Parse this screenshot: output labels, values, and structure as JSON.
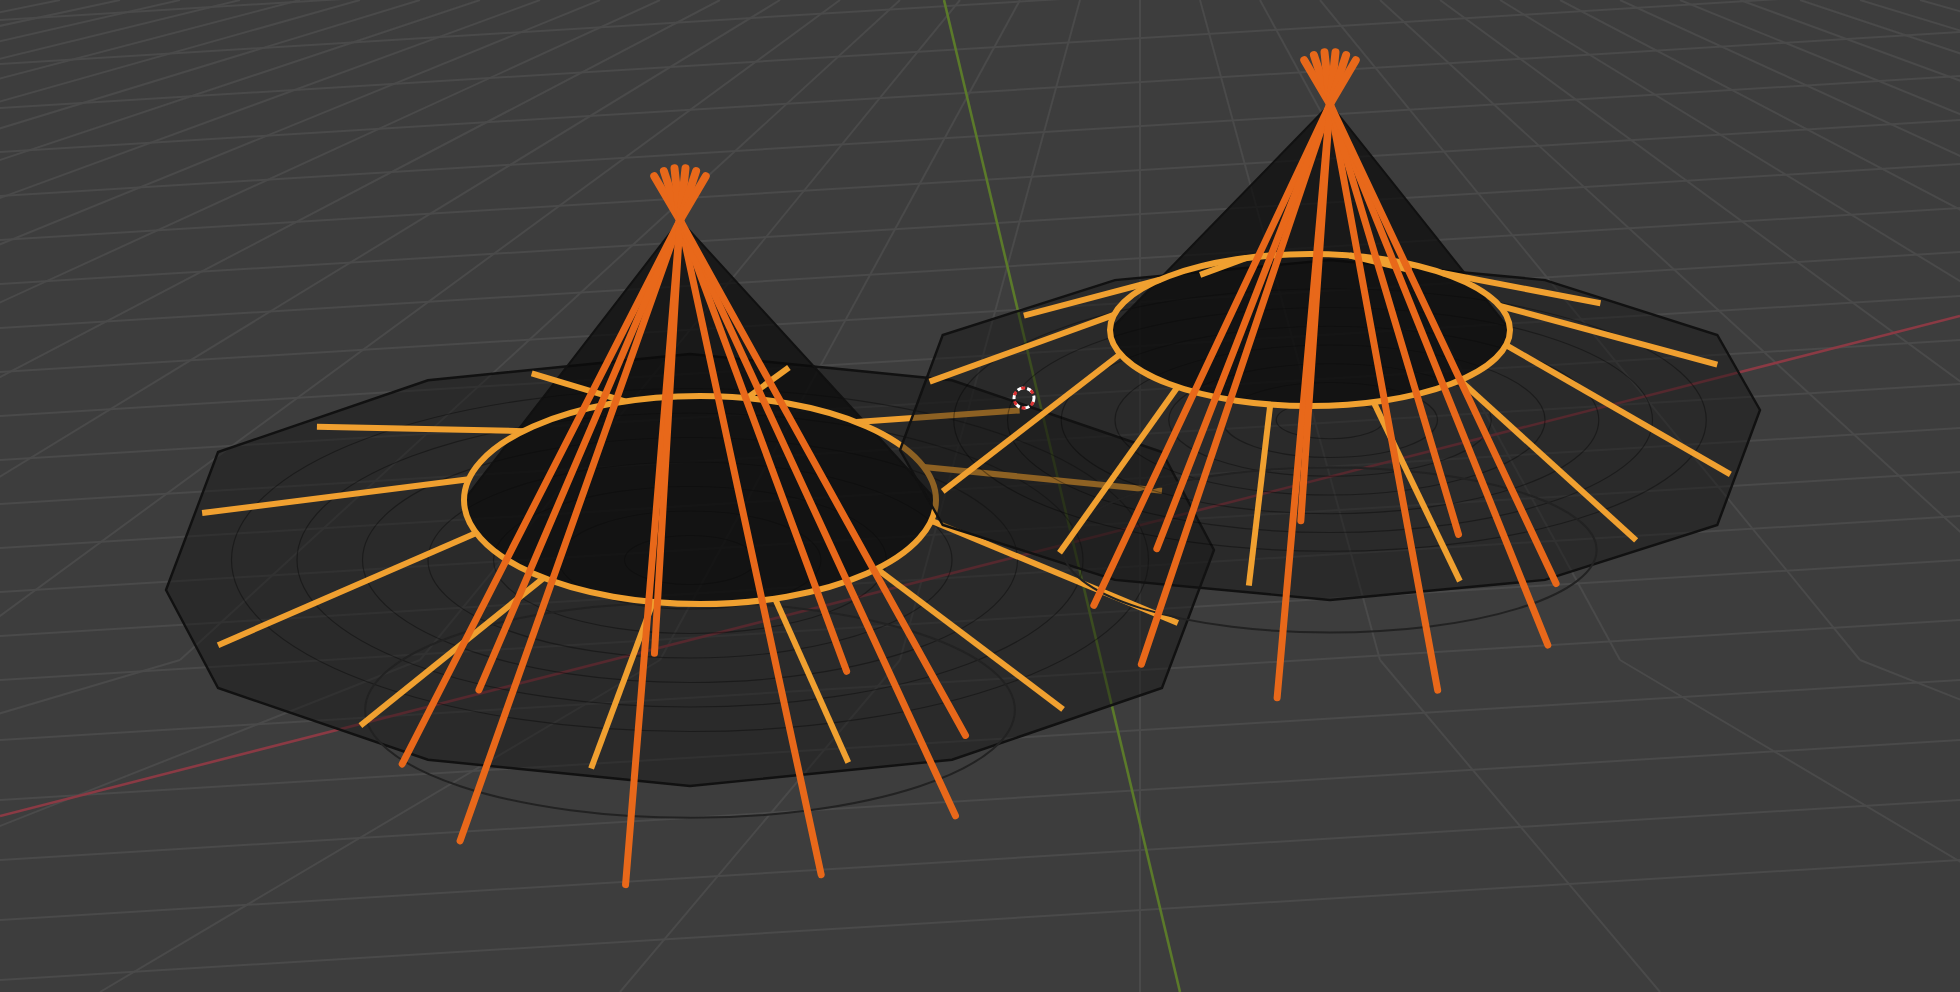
{
  "viewport": {
    "axes": true,
    "cursor": true
  },
  "objects": [
    {
      "kind": "tent",
      "selected": true
    },
    {
      "kind": "tent",
      "selected": true
    }
  ]
}
